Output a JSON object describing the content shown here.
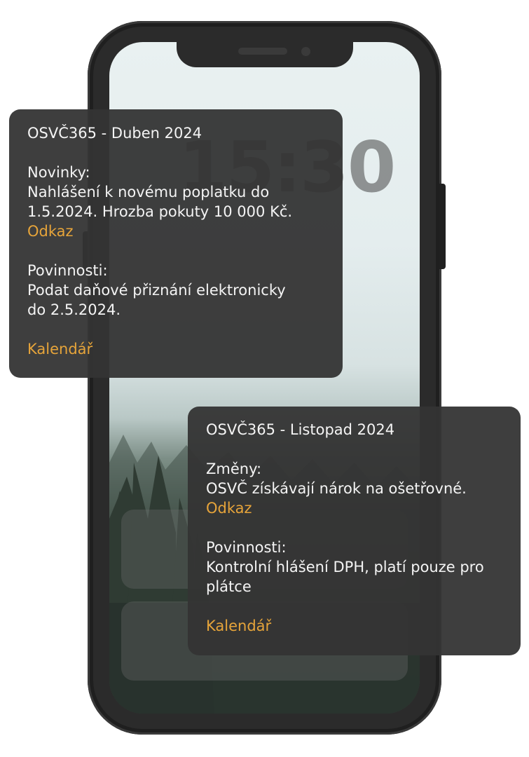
{
  "lockscreen": {
    "time": "15:30"
  },
  "cards": [
    {
      "title": "OSVČ365 - Duben 2024",
      "section1_heading": "Novinky:",
      "section1_line1": "Nahlášení k novému poplatku do",
      "section1_line2": "1.5.2024. Hrozba pokuty 10 000 Kč.",
      "link_label": "Odkaz",
      "section2_heading": "Povinnosti:",
      "section2_line1": "Podat daňové přiznání elektronicky",
      "section2_line2": "do 2.5.2024.",
      "calendar_label": "Kalendář"
    },
    {
      "title": "OSVČ365 - Listopad 2024",
      "section1_heading": "Změny:",
      "section1_line1": "OSVČ získávají nárok na ošetřovné.",
      "link_label": "Odkaz",
      "section2_heading": "Povinnosti:",
      "section2_line1": "Kontrolní hlášení DPH, platí pouze pro",
      "section2_line2": "plátce",
      "calendar_label": "Kalendář"
    }
  ],
  "colors": {
    "accent": "#e6a43a",
    "card_bg": "#343434",
    "phone_frame": "#2b2b2b"
  }
}
